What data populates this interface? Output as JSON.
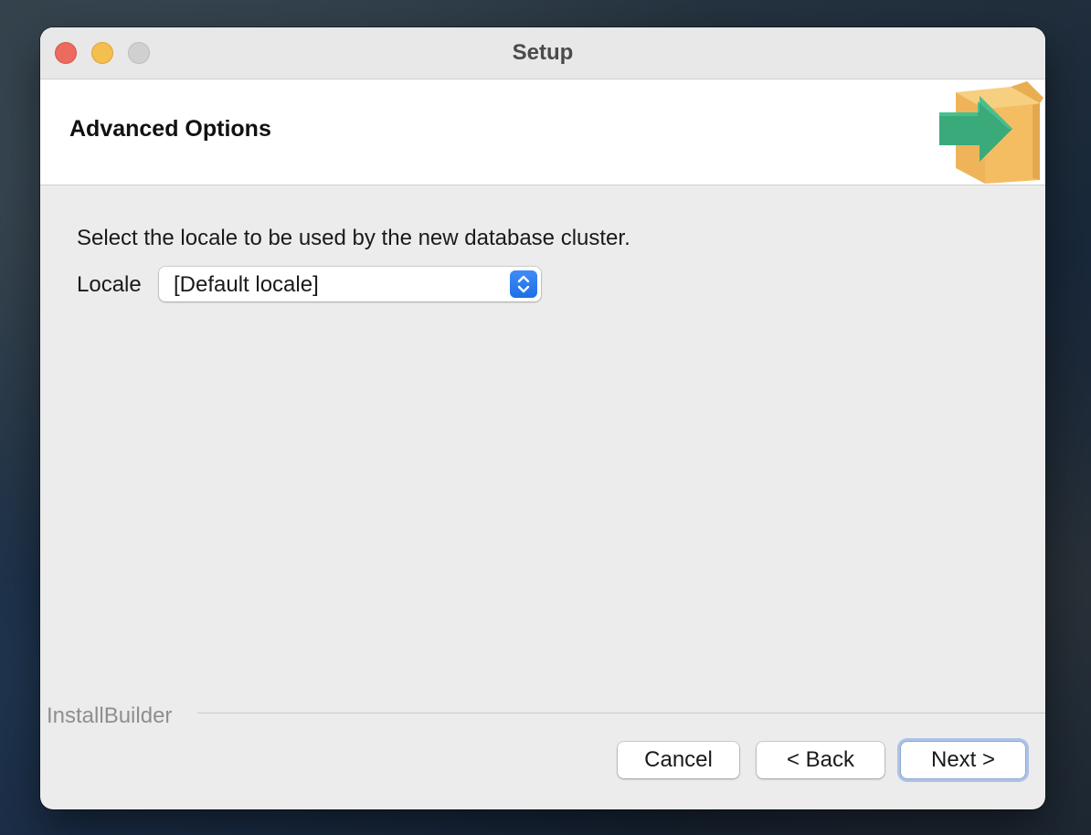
{
  "window": {
    "title": "Setup",
    "controls": [
      "close",
      "minimize",
      "zoom"
    ]
  },
  "header": {
    "title": "Advanced Options",
    "icon": "installer-box-arrow-icon"
  },
  "content": {
    "instruction": "Select the locale to be used by the new database cluster.",
    "locale_label": "Locale",
    "locale_value": "[Default locale]"
  },
  "footer": {
    "brand": "InstallBuilder",
    "cancel_label": "Cancel",
    "back_label": "< Back",
    "next_label": "Next >"
  },
  "colors": {
    "close": "#ed6a5e",
    "minimize": "#f5bf4f",
    "zoom": "#d0d0d0",
    "accent": "#2f7cf0",
    "box": "#f4bd62",
    "arrow": "#3aaa7a"
  }
}
